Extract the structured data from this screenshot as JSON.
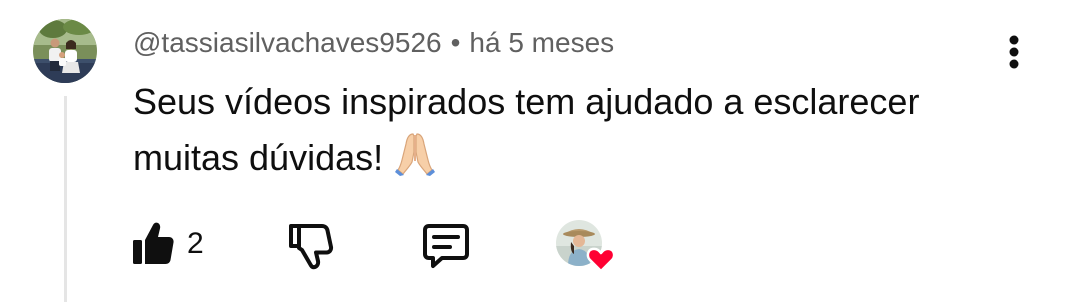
{
  "comment": {
    "author": "@tassiasilvachaves9526",
    "separator": "•",
    "time": "há 5 meses",
    "text": "Seus vídeos inspirados tem ajudado a esclarecer muitas dúvidas!",
    "emoji_icon": "folded-hands-icon",
    "avatar_icon": "user-avatar"
  },
  "actions": {
    "like_icon": "thumbs-up-icon",
    "like_count": "2",
    "dislike_icon": "thumbs-down-icon",
    "reply_icon": "reply-comment-icon",
    "creator_heart_icon": "creator-heart-icon",
    "more_icon": "more-vertical-icon"
  },
  "colors": {
    "primary_text": "#0f0f0f",
    "secondary_text": "#606060",
    "thread_line": "#e5e5e5",
    "heart": "#ff0033"
  }
}
